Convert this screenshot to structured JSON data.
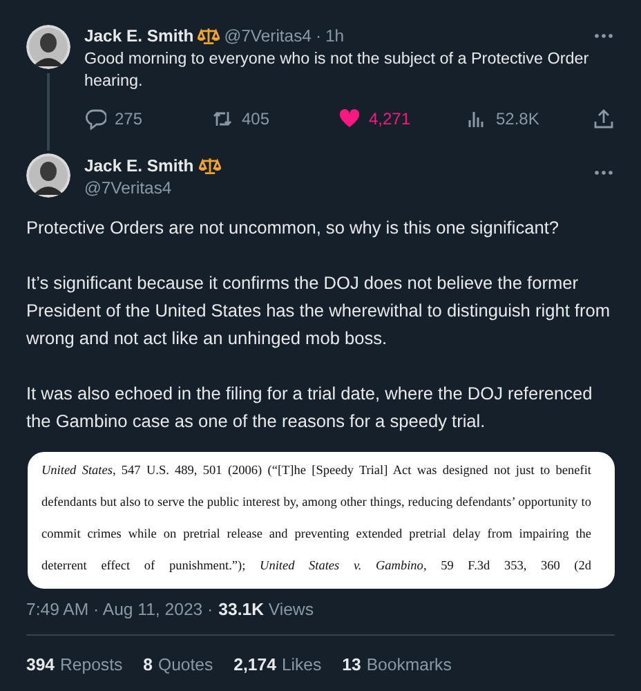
{
  "reply_tweet": {
    "author": {
      "name": "Jack E. Smith",
      "handle": "@7Veritas4",
      "separator": "·",
      "time": "1h"
    },
    "text": "Good morning to everyone who is not the subject of a Protective Order hearing.",
    "actions": [
      {
        "kind": "reply",
        "count": "275"
      },
      {
        "kind": "repost",
        "count": "405"
      },
      {
        "kind": "like",
        "count": "4,271",
        "liked": true
      },
      {
        "kind": "views",
        "count": "52.8K"
      },
      {
        "kind": "share"
      }
    ]
  },
  "main_tweet": {
    "author": {
      "name": "Jack E. Smith",
      "handle": "@7Veritas4"
    },
    "paragraphs": [
      "Protective Orders are not uncommon, so why is this one significant?",
      "It’s significant because it confirms the DOJ does not believe the former President of the United States has the wherewithal to distinguish right from wrong and not act like an unhinged mob boss.",
      "It was also echoed in the filing for a trial date, where the DOJ referenced the Gambino case as one of the reasons for a speedy trial."
    ],
    "document_excerpt": "*United States*, 547 U.S. 489, 501 (2006) (“[T]he [Speedy Trial] Act was designed not just to benefit defendants but also to serve the public interest by, among other things, reducing defendants’ opportunity to commit crimes while on pretrial release and preventing extended pretrial delay from impairing the deterrent effect of punishment.”); *United States v. Gambino*, 59 F.3d 353, 360 (2d",
    "timestamp": "7:49 AM · Aug 11, 2023 · ",
    "views_count": "33.1K",
    "views_label": "Views",
    "stats": [
      {
        "count": "394",
        "label": "Reposts"
      },
      {
        "count": "8",
        "label": "Quotes"
      },
      {
        "count": "2,174",
        "label": "Likes"
      },
      {
        "count": "13",
        "label": "Bookmarks"
      }
    ]
  }
}
